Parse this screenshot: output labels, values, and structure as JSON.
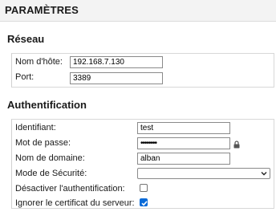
{
  "header": {
    "title": "PARAMÈTRES"
  },
  "network": {
    "title": "Réseau",
    "hostname_label": "Nom d'hôte:",
    "hostname_value": "192.168.7.130",
    "port_label": "Port:",
    "port_value": "3389"
  },
  "auth": {
    "title": "Authentification",
    "username_label": "Identifiant:",
    "username_value": "test",
    "password_label": "Mot de passe:",
    "password_value": "••••••••",
    "domain_label": "Nom de domaine:",
    "domain_value": "alban",
    "security_label": "Mode de Sécurité:",
    "security_value": "",
    "disable_auth_label": "Désactiver l'authentification:",
    "disable_auth_checked": false,
    "ignore_cert_label": "Ignorer le certificat du serveur:",
    "ignore_cert_checked": true
  },
  "colors": {
    "accent": "#0a6bd8",
    "header_bg": "#f3f3f3"
  }
}
